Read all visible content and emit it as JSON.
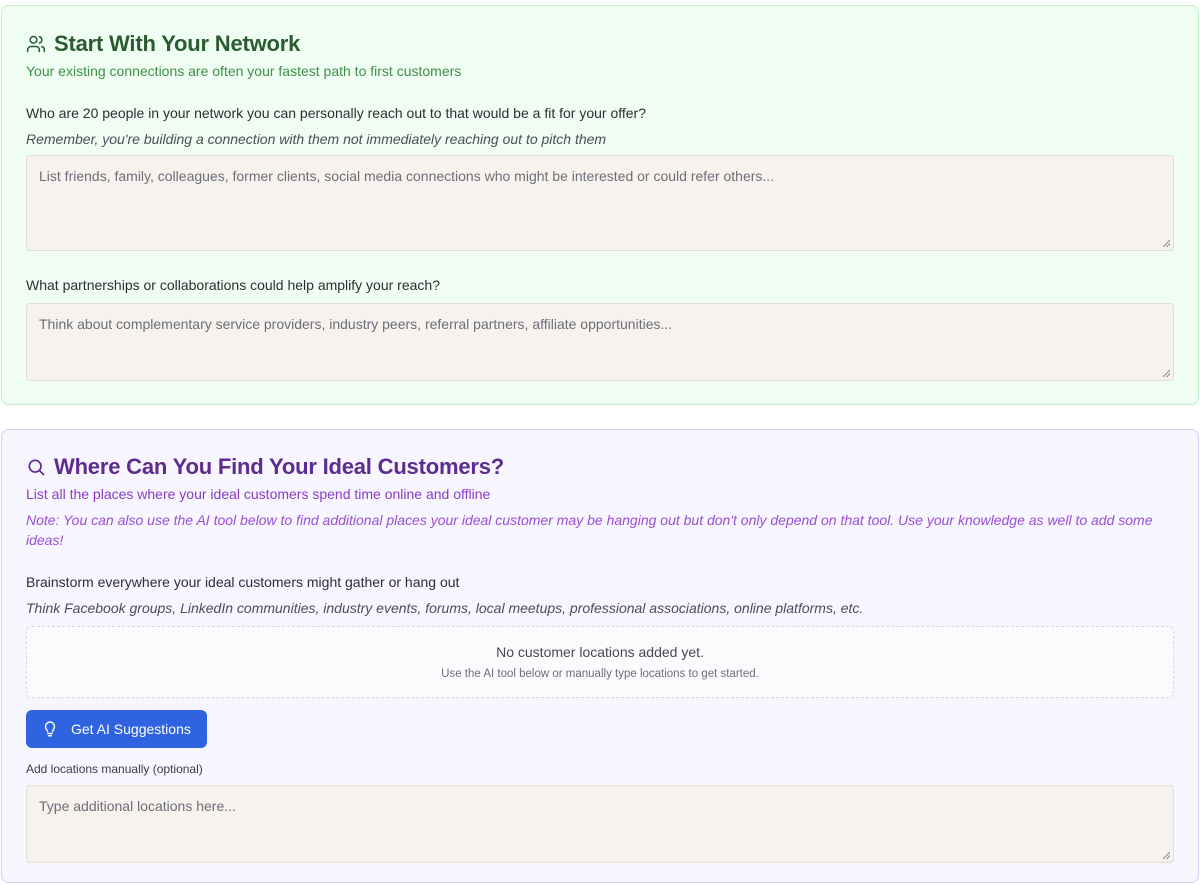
{
  "network": {
    "title": "Start With Your Network",
    "subtitle": "Your existing connections are often your fastest path to first customers",
    "q1": {
      "question": "Who are 20 people in your network you can personally reach out to that would be a fit for your offer?",
      "hint": "Remember, you're building a connection with them not immediately reaching out to pitch them",
      "placeholder": "List friends, family, colleagues, former clients, social media connections who might be interested or could refer others..."
    },
    "q2": {
      "question": "What partnerships or collaborations could help amplify your reach?",
      "placeholder": "Think about complementary service providers, industry peers, referral partners, affiliate opportunities..."
    },
    "icon": "users-icon",
    "title_color": "#2a5c31",
    "accent_bg": "#effdf2"
  },
  "find": {
    "title": "Where Can You Find Your Ideal Customers?",
    "subtitle": "List all the places where your ideal customers spend time online and offline",
    "note": "Note: You can also use the AI tool below to find additional places your ideal customer may be hanging out but don't only depend on that tool. Use your knowledge as well to add some ideas!",
    "question": "Brainstorm everywhere your ideal customers might gather or hang out",
    "hint": "Think Facebook groups, LinkedIn communities, industry events, forums, local meetups, professional associations, online platforms, etc.",
    "empty_title": "No customer locations added yet.",
    "empty_sub": "Use the AI tool below or manually type locations to get started.",
    "ai_button_label": "Get AI Suggestions",
    "manual_label": "Add locations manually (optional)",
    "manual_placeholder": "Type additional locations here...",
    "icon": "search-icon",
    "title_color": "#5c2c8f",
    "accent_bg": "#f7f5fe",
    "button_color": "#2f63e0"
  }
}
